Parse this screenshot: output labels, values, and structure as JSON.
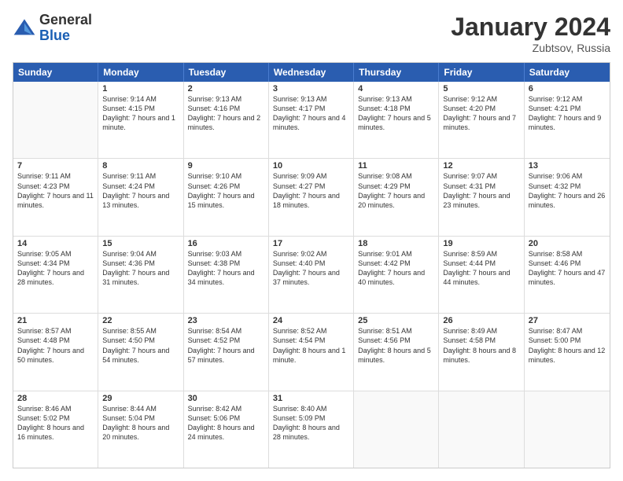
{
  "header": {
    "logo_general": "General",
    "logo_blue": "Blue",
    "month_title": "January 2024",
    "subtitle": "Zubtsov, Russia"
  },
  "calendar": {
    "days_of_week": [
      "Sunday",
      "Monday",
      "Tuesday",
      "Wednesday",
      "Thursday",
      "Friday",
      "Saturday"
    ],
    "rows": [
      [
        {
          "day": "",
          "empty": true
        },
        {
          "day": "1",
          "sunrise": "9:14 AM",
          "sunset": "4:15 PM",
          "daylight": "7 hours and 1 minute."
        },
        {
          "day": "2",
          "sunrise": "9:13 AM",
          "sunset": "4:16 PM",
          "daylight": "7 hours and 2 minutes."
        },
        {
          "day": "3",
          "sunrise": "9:13 AM",
          "sunset": "4:17 PM",
          "daylight": "7 hours and 4 minutes."
        },
        {
          "day": "4",
          "sunrise": "9:13 AM",
          "sunset": "4:18 PM",
          "daylight": "7 hours and 5 minutes."
        },
        {
          "day": "5",
          "sunrise": "9:12 AM",
          "sunset": "4:20 PM",
          "daylight": "7 hours and 7 minutes."
        },
        {
          "day": "6",
          "sunrise": "9:12 AM",
          "sunset": "4:21 PM",
          "daylight": "7 hours and 9 minutes."
        }
      ],
      [
        {
          "day": "7",
          "sunrise": "9:11 AM",
          "sunset": "4:23 PM",
          "daylight": "7 hours and 11 minutes."
        },
        {
          "day": "8",
          "sunrise": "9:11 AM",
          "sunset": "4:24 PM",
          "daylight": "7 hours and 13 minutes."
        },
        {
          "day": "9",
          "sunrise": "9:10 AM",
          "sunset": "4:26 PM",
          "daylight": "7 hours and 15 minutes."
        },
        {
          "day": "10",
          "sunrise": "9:09 AM",
          "sunset": "4:27 PM",
          "daylight": "7 hours and 18 minutes."
        },
        {
          "day": "11",
          "sunrise": "9:08 AM",
          "sunset": "4:29 PM",
          "daylight": "7 hours and 20 minutes."
        },
        {
          "day": "12",
          "sunrise": "9:07 AM",
          "sunset": "4:31 PM",
          "daylight": "7 hours and 23 minutes."
        },
        {
          "day": "13",
          "sunrise": "9:06 AM",
          "sunset": "4:32 PM",
          "daylight": "7 hours and 26 minutes."
        }
      ],
      [
        {
          "day": "14",
          "sunrise": "9:05 AM",
          "sunset": "4:34 PM",
          "daylight": "7 hours and 28 minutes."
        },
        {
          "day": "15",
          "sunrise": "9:04 AM",
          "sunset": "4:36 PM",
          "daylight": "7 hours and 31 minutes."
        },
        {
          "day": "16",
          "sunrise": "9:03 AM",
          "sunset": "4:38 PM",
          "daylight": "7 hours and 34 minutes."
        },
        {
          "day": "17",
          "sunrise": "9:02 AM",
          "sunset": "4:40 PM",
          "daylight": "7 hours and 37 minutes."
        },
        {
          "day": "18",
          "sunrise": "9:01 AM",
          "sunset": "4:42 PM",
          "daylight": "7 hours and 40 minutes."
        },
        {
          "day": "19",
          "sunrise": "8:59 AM",
          "sunset": "4:44 PM",
          "daylight": "7 hours and 44 minutes."
        },
        {
          "day": "20",
          "sunrise": "8:58 AM",
          "sunset": "4:46 PM",
          "daylight": "7 hours and 47 minutes."
        }
      ],
      [
        {
          "day": "21",
          "sunrise": "8:57 AM",
          "sunset": "4:48 PM",
          "daylight": "7 hours and 50 minutes."
        },
        {
          "day": "22",
          "sunrise": "8:55 AM",
          "sunset": "4:50 PM",
          "daylight": "7 hours and 54 minutes."
        },
        {
          "day": "23",
          "sunrise": "8:54 AM",
          "sunset": "4:52 PM",
          "daylight": "7 hours and 57 minutes."
        },
        {
          "day": "24",
          "sunrise": "8:52 AM",
          "sunset": "4:54 PM",
          "daylight": "8 hours and 1 minute."
        },
        {
          "day": "25",
          "sunrise": "8:51 AM",
          "sunset": "4:56 PM",
          "daylight": "8 hours and 5 minutes."
        },
        {
          "day": "26",
          "sunrise": "8:49 AM",
          "sunset": "4:58 PM",
          "daylight": "8 hours and 8 minutes."
        },
        {
          "day": "27",
          "sunrise": "8:47 AM",
          "sunset": "5:00 PM",
          "daylight": "8 hours and 12 minutes."
        }
      ],
      [
        {
          "day": "28",
          "sunrise": "8:46 AM",
          "sunset": "5:02 PM",
          "daylight": "8 hours and 16 minutes."
        },
        {
          "day": "29",
          "sunrise": "8:44 AM",
          "sunset": "5:04 PM",
          "daylight": "8 hours and 20 minutes."
        },
        {
          "day": "30",
          "sunrise": "8:42 AM",
          "sunset": "5:06 PM",
          "daylight": "8 hours and 24 minutes."
        },
        {
          "day": "31",
          "sunrise": "8:40 AM",
          "sunset": "5:09 PM",
          "daylight": "8 hours and 28 minutes."
        },
        {
          "day": "",
          "empty": true
        },
        {
          "day": "",
          "empty": true
        },
        {
          "day": "",
          "empty": true
        }
      ]
    ]
  }
}
